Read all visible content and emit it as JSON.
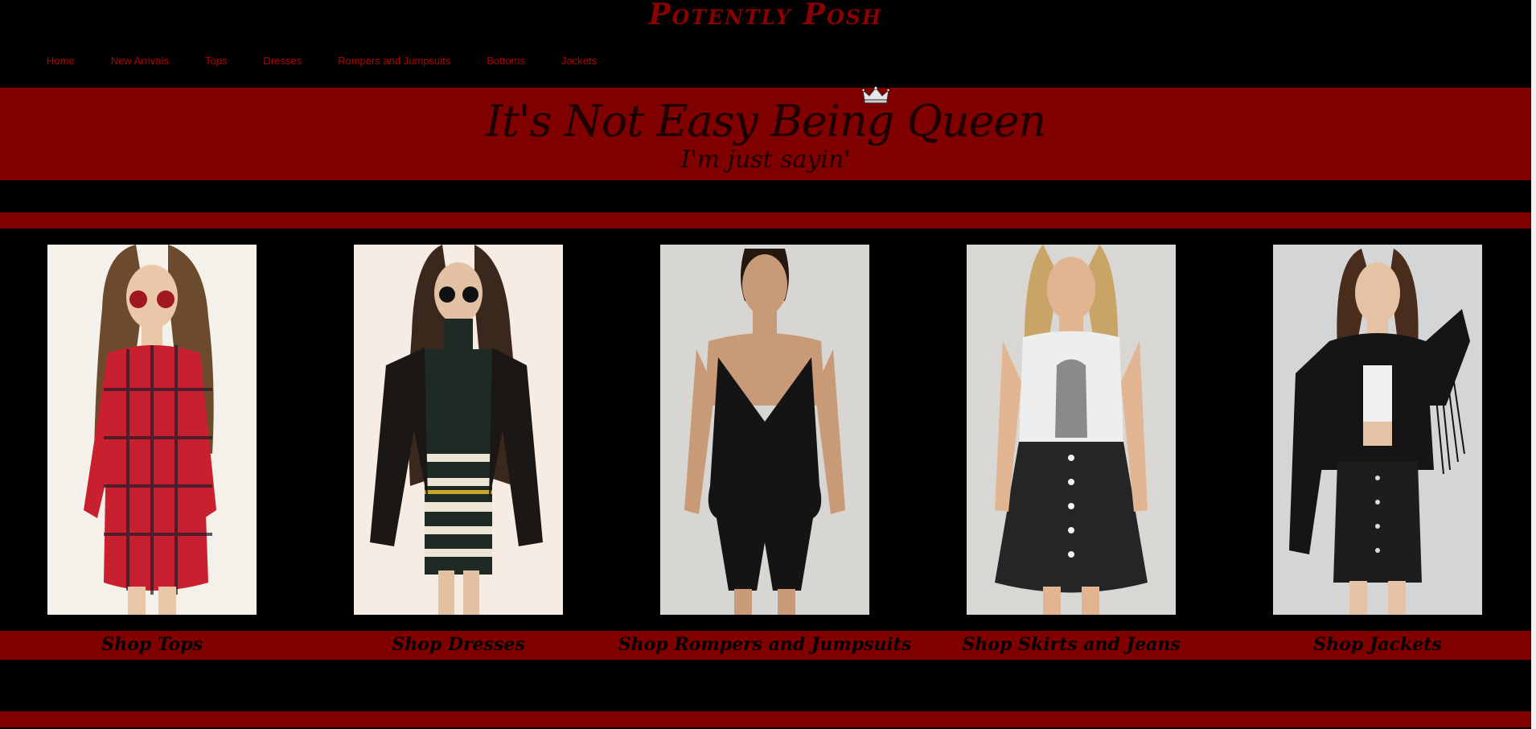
{
  "site": {
    "title": "Potently Posh"
  },
  "nav": {
    "items": [
      "Home",
      "New Arrivals",
      "Tops",
      "Dresses",
      "Rompers and Jumpsuits",
      "Bottoms",
      "Jackets"
    ]
  },
  "banner": {
    "title": "It's Not Easy Being Queen",
    "subtitle": "I'm just sayin'",
    "crown_icon": "crown-icon"
  },
  "categories": [
    {
      "label": "Shop Tops",
      "image": "woman in red plaid shirt dress with round sunglasses"
    },
    {
      "label": "Shop Dresses",
      "image": "woman in striped bodycon dress and black leather jacket"
    },
    {
      "label": "Shop Rompers and Jumpsuits",
      "image": "woman in black satin romper"
    },
    {
      "label": "Shop Skirts and Jeans",
      "image": "woman in graphic tee and black denim button skirt"
    },
    {
      "label": "Shop Jackets",
      "image": "woman in black fringe leather jacket"
    }
  ],
  "colors": {
    "background": "#000000",
    "accent": "#800000",
    "nav_text": "#b30000",
    "title": "#8b0000"
  }
}
